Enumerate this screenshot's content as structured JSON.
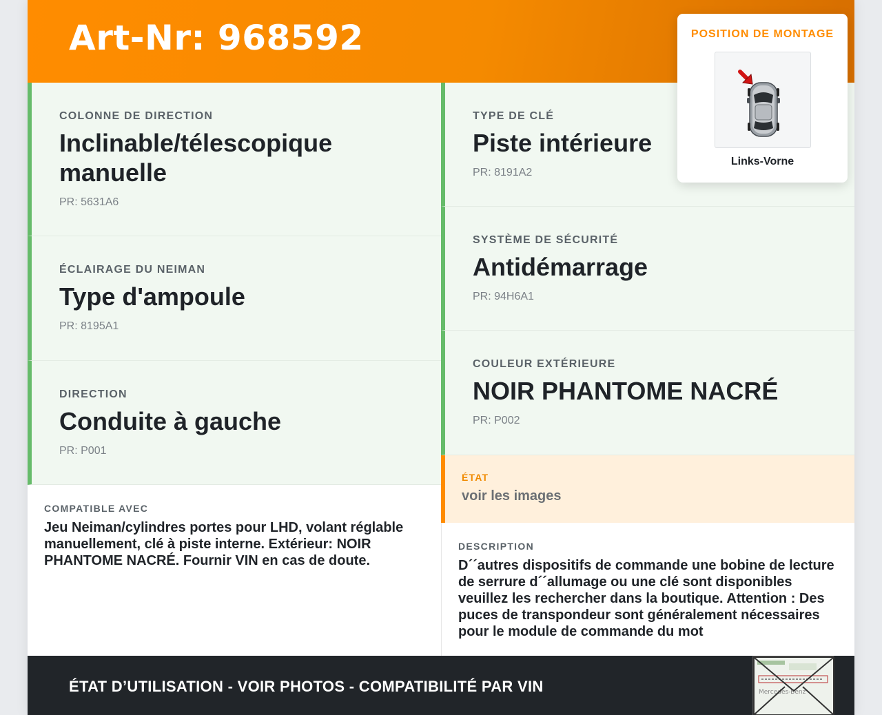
{
  "header": {
    "title": "Art-Nr: 968592"
  },
  "specs_left": [
    {
      "label": "COLONNE DE DIRECTION",
      "value": "Inclinable/télescopique manuelle",
      "pr": "PR: 5631A6"
    },
    {
      "label": "ÉCLAIRAGE DU NEIMAN",
      "value": "Type d'ampoule",
      "pr": "PR: 8195A1"
    },
    {
      "label": "DIRECTION",
      "value": "Conduite à gauche",
      "pr": "PR: P001"
    }
  ],
  "specs_right": [
    {
      "label": "TYPE DE CLÉ",
      "value": "Piste intérieure",
      "pr": "PR: 8191A2"
    },
    {
      "label": "SYSTÈME DE SÉCURITÉ",
      "value": "Antidémarrage",
      "pr": "PR: 94H6A1"
    },
    {
      "label": "COULEUR EXTÉRIEURE",
      "value": "NOIR PHANTOME NACRÉ",
      "pr": "PR: P002"
    }
  ],
  "etat": {
    "label": "ÉTAT",
    "value": "voir les images"
  },
  "compatible": {
    "label": "COMPATIBLE AVEC",
    "text": "Jeu Neiman/cylindres portes pour LHD, volant réglable manuellement, clé à piste interne. Extérieur: NOIR PHANTOME NACRÉ. Fournir VIN en cas de doute."
  },
  "description": {
    "label": "DESCRIPTION",
    "text": "D´´autres dispositifs de commande une bobine de lecture de serrure d´´allumage ou une clé sont disponibles veuillez les rechercher dans la boutique. Attention : Des puces de transpondeur sont généralement nécessaires pour le module de commande du mot"
  },
  "mount": {
    "title": "POSITION DE MONTAGE",
    "caption": "Links-Vorne",
    "image_icon": "car-top-view-icon",
    "arrow_icon": "red-arrow-front-left-icon"
  },
  "footer": {
    "text": "ÉTAT D’UTILISATION - VOIR PHOTOS - COMPATIBILITÉ PAR VIN",
    "stamp_icon": "document-envelope-icon",
    "stamp_text": "Mercedes-Benz"
  },
  "colors": {
    "accent_orange": "#ff8c00",
    "spec_green": "#66bb6a",
    "spec_bg": "#f1f8f1",
    "etat_bg": "#fff0dc",
    "footer_bg": "#212529"
  }
}
